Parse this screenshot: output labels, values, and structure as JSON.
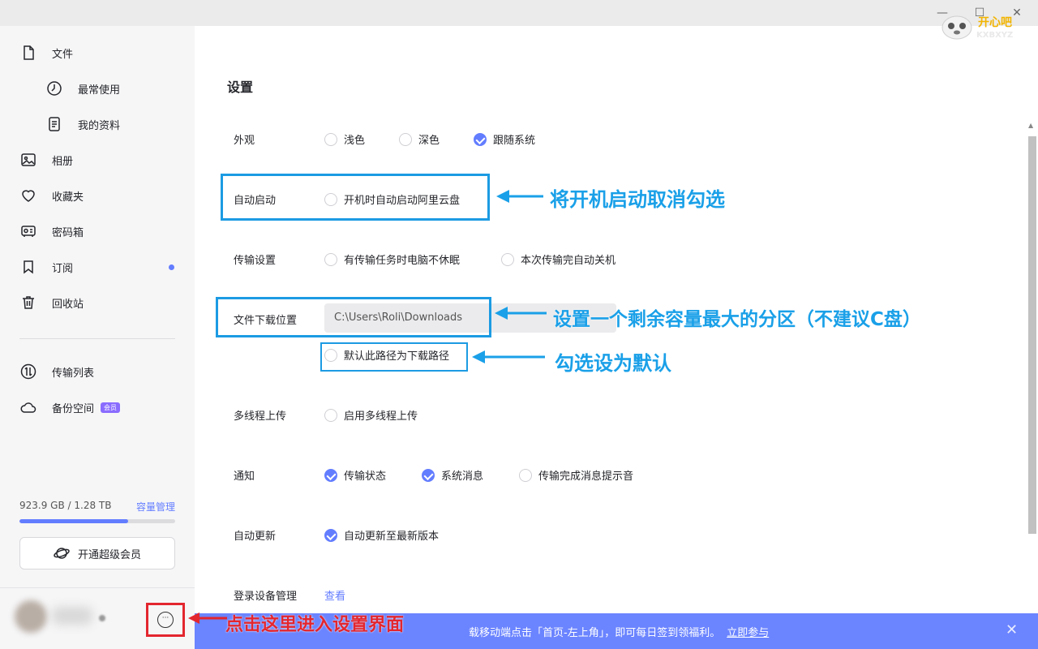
{
  "window": {
    "minimize": "—",
    "maximize": "☐",
    "close": "✕"
  },
  "watermark": {
    "line1": "开心吧",
    "line2": "KXBXYZ"
  },
  "sidebar": {
    "items": [
      {
        "label": "文件",
        "icon": "file-icon"
      },
      {
        "label": "最常使用",
        "icon": "clock-icon"
      },
      {
        "label": "我的资料",
        "icon": "document-icon"
      },
      {
        "label": "相册",
        "icon": "photo-icon"
      },
      {
        "label": "收藏夹",
        "icon": "heart-icon"
      },
      {
        "label": "密码箱",
        "icon": "safe-icon"
      },
      {
        "label": "订阅",
        "icon": "bookmark-icon"
      },
      {
        "label": "回收站",
        "icon": "trash-icon"
      },
      {
        "label": "传输列表",
        "icon": "transfer-icon"
      },
      {
        "label": "备份空间",
        "icon": "cloud-icon"
      }
    ],
    "vip_tag": "会员",
    "storage": {
      "text": "923.9 GB / 1.28 TB",
      "manage": "容量管理",
      "used_fraction": 0.7
    },
    "vip_button": "开通超级会员"
  },
  "settings": {
    "title": "设置",
    "appearance": {
      "label": "外观",
      "options": [
        "浅色",
        "深色",
        "跟随系统"
      ],
      "selected": 2
    },
    "autostart": {
      "label": "自动启动",
      "option": "开机时自动启动阿里云盘"
    },
    "transfer": {
      "label": "传输设置",
      "options": [
        "有传输任务时电脑不休眠",
        "本次传输完自动关机"
      ]
    },
    "download": {
      "label": "文件下载位置",
      "path": "C:\\Users\\Roli\\Downloads",
      "default_option": "默认此路径为下载路径"
    },
    "multithread": {
      "label": "多线程上传",
      "option": "启用多线程上传"
    },
    "notify": {
      "label": "通知",
      "options": [
        "传输状态",
        "系统消息",
        "传输完成消息提示音"
      ]
    },
    "autoupdate": {
      "label": "自动更新",
      "option": "自动更新至最新版本"
    },
    "devices": {
      "label": "登录设备管理",
      "link": "查看"
    }
  },
  "banner": {
    "text": "载移动端点击「首页-左上角」，即可每日签到领福利。",
    "link": "立即参与",
    "close": "✕"
  },
  "annotations": {
    "autostart": "将开机启动取消勾选",
    "download": "设置一个剩余容量最大的分区（不建议C盘）",
    "default": "勾选设为默认",
    "more": "点击这里进入设置界面"
  },
  "colors": {
    "accent": "#637dff",
    "annotation_blue": "#1aa0e8",
    "annotation_red": "#e3262e"
  }
}
